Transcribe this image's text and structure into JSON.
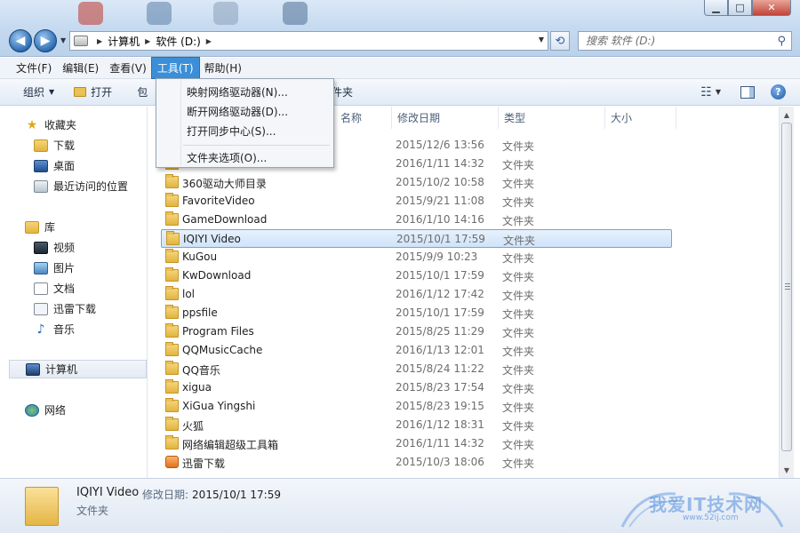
{
  "window": {
    "minimize": "▁",
    "maximize": "□",
    "close": "✕"
  },
  "address": {
    "crumbs": [
      "计算机",
      "软件 (D:)"
    ],
    "search_placeholder": "搜索 软件 (D:)"
  },
  "menubar": {
    "items": [
      "文件(F)",
      "编辑(E)",
      "查看(V)",
      "工具(T)",
      "帮助(H)"
    ],
    "active_index": 3
  },
  "toolbar": {
    "organize": "组织",
    "open": "打开",
    "hidden_left": "包",
    "hidden_right": "件夹"
  },
  "tools_menu": {
    "items": [
      "映射网络驱动器(N)...",
      "断开网络驱动器(D)...",
      "打开同步中心(S)...",
      "文件夹选项(O)..."
    ]
  },
  "navpane": {
    "favorites": {
      "label": "收藏夹",
      "items": [
        "下载",
        "桌面",
        "最近访问的位置"
      ]
    },
    "libraries": {
      "label": "库",
      "items": [
        "视频",
        "图片",
        "文档",
        "迅雷下载",
        "音乐"
      ]
    },
    "computer": "计算机",
    "network": "网络"
  },
  "columns": {
    "name": "名称",
    "modified": "修改日期",
    "type": "类型",
    "size": "大小"
  },
  "files": [
    {
      "name": "",
      "date": "2015/12/6 13:56",
      "type": "文件夹",
      "icon": "folder"
    },
    {
      "name": "",
      "date": "2016/1/11 14:32",
      "type": "文件夹",
      "icon": "folder"
    },
    {
      "name": "360驱动大师目录",
      "date": "2015/10/2 10:58",
      "type": "文件夹",
      "icon": "folder"
    },
    {
      "name": "FavoriteVideo",
      "date": "2015/9/21 11:08",
      "type": "文件夹",
      "icon": "folder"
    },
    {
      "name": "GameDownload",
      "date": "2016/1/10 14:16",
      "type": "文件夹",
      "icon": "folder"
    },
    {
      "name": "IQIYI Video",
      "date": "2015/10/1 17:59",
      "type": "文件夹",
      "icon": "folder",
      "selected": true
    },
    {
      "name": "KuGou",
      "date": "2015/9/9 10:23",
      "type": "文件夹",
      "icon": "folder"
    },
    {
      "name": "KwDownload",
      "date": "2015/10/1 17:59",
      "type": "文件夹",
      "icon": "folder"
    },
    {
      "name": "lol",
      "date": "2016/1/12 17:42",
      "type": "文件夹",
      "icon": "folder"
    },
    {
      "name": "ppsfile",
      "date": "2015/10/1 17:59",
      "type": "文件夹",
      "icon": "folder"
    },
    {
      "name": "Program Files",
      "date": "2015/8/25 11:29",
      "type": "文件夹",
      "icon": "folder"
    },
    {
      "name": "QQMusicCache",
      "date": "2016/1/13 12:01",
      "type": "文件夹",
      "icon": "folder"
    },
    {
      "name": "QQ音乐",
      "date": "2015/8/24 11:22",
      "type": "文件夹",
      "icon": "folder"
    },
    {
      "name": "xigua",
      "date": "2015/8/23 17:54",
      "type": "文件夹",
      "icon": "folder"
    },
    {
      "name": "XiGua Yingshi",
      "date": "2015/8/23 19:15",
      "type": "文件夹",
      "icon": "folder"
    },
    {
      "name": "火狐",
      "date": "2016/1/12 18:31",
      "type": "文件夹",
      "icon": "folder"
    },
    {
      "name": "网络编辑超级工具箱",
      "date": "2016/1/11 14:32",
      "type": "文件夹",
      "icon": "folder"
    },
    {
      "name": "迅雷下载",
      "date": "2015/10/3 18:06",
      "type": "文件夹",
      "icon": "app-folder"
    }
  ],
  "details": {
    "name": "IQIYI Video",
    "modified_label": "修改日期:",
    "modified_value": "2015/10/1 17:59",
    "type": "文件夹"
  },
  "watermark": {
    "text": "我爱IT技术网",
    "url": "www.52ij.com"
  }
}
